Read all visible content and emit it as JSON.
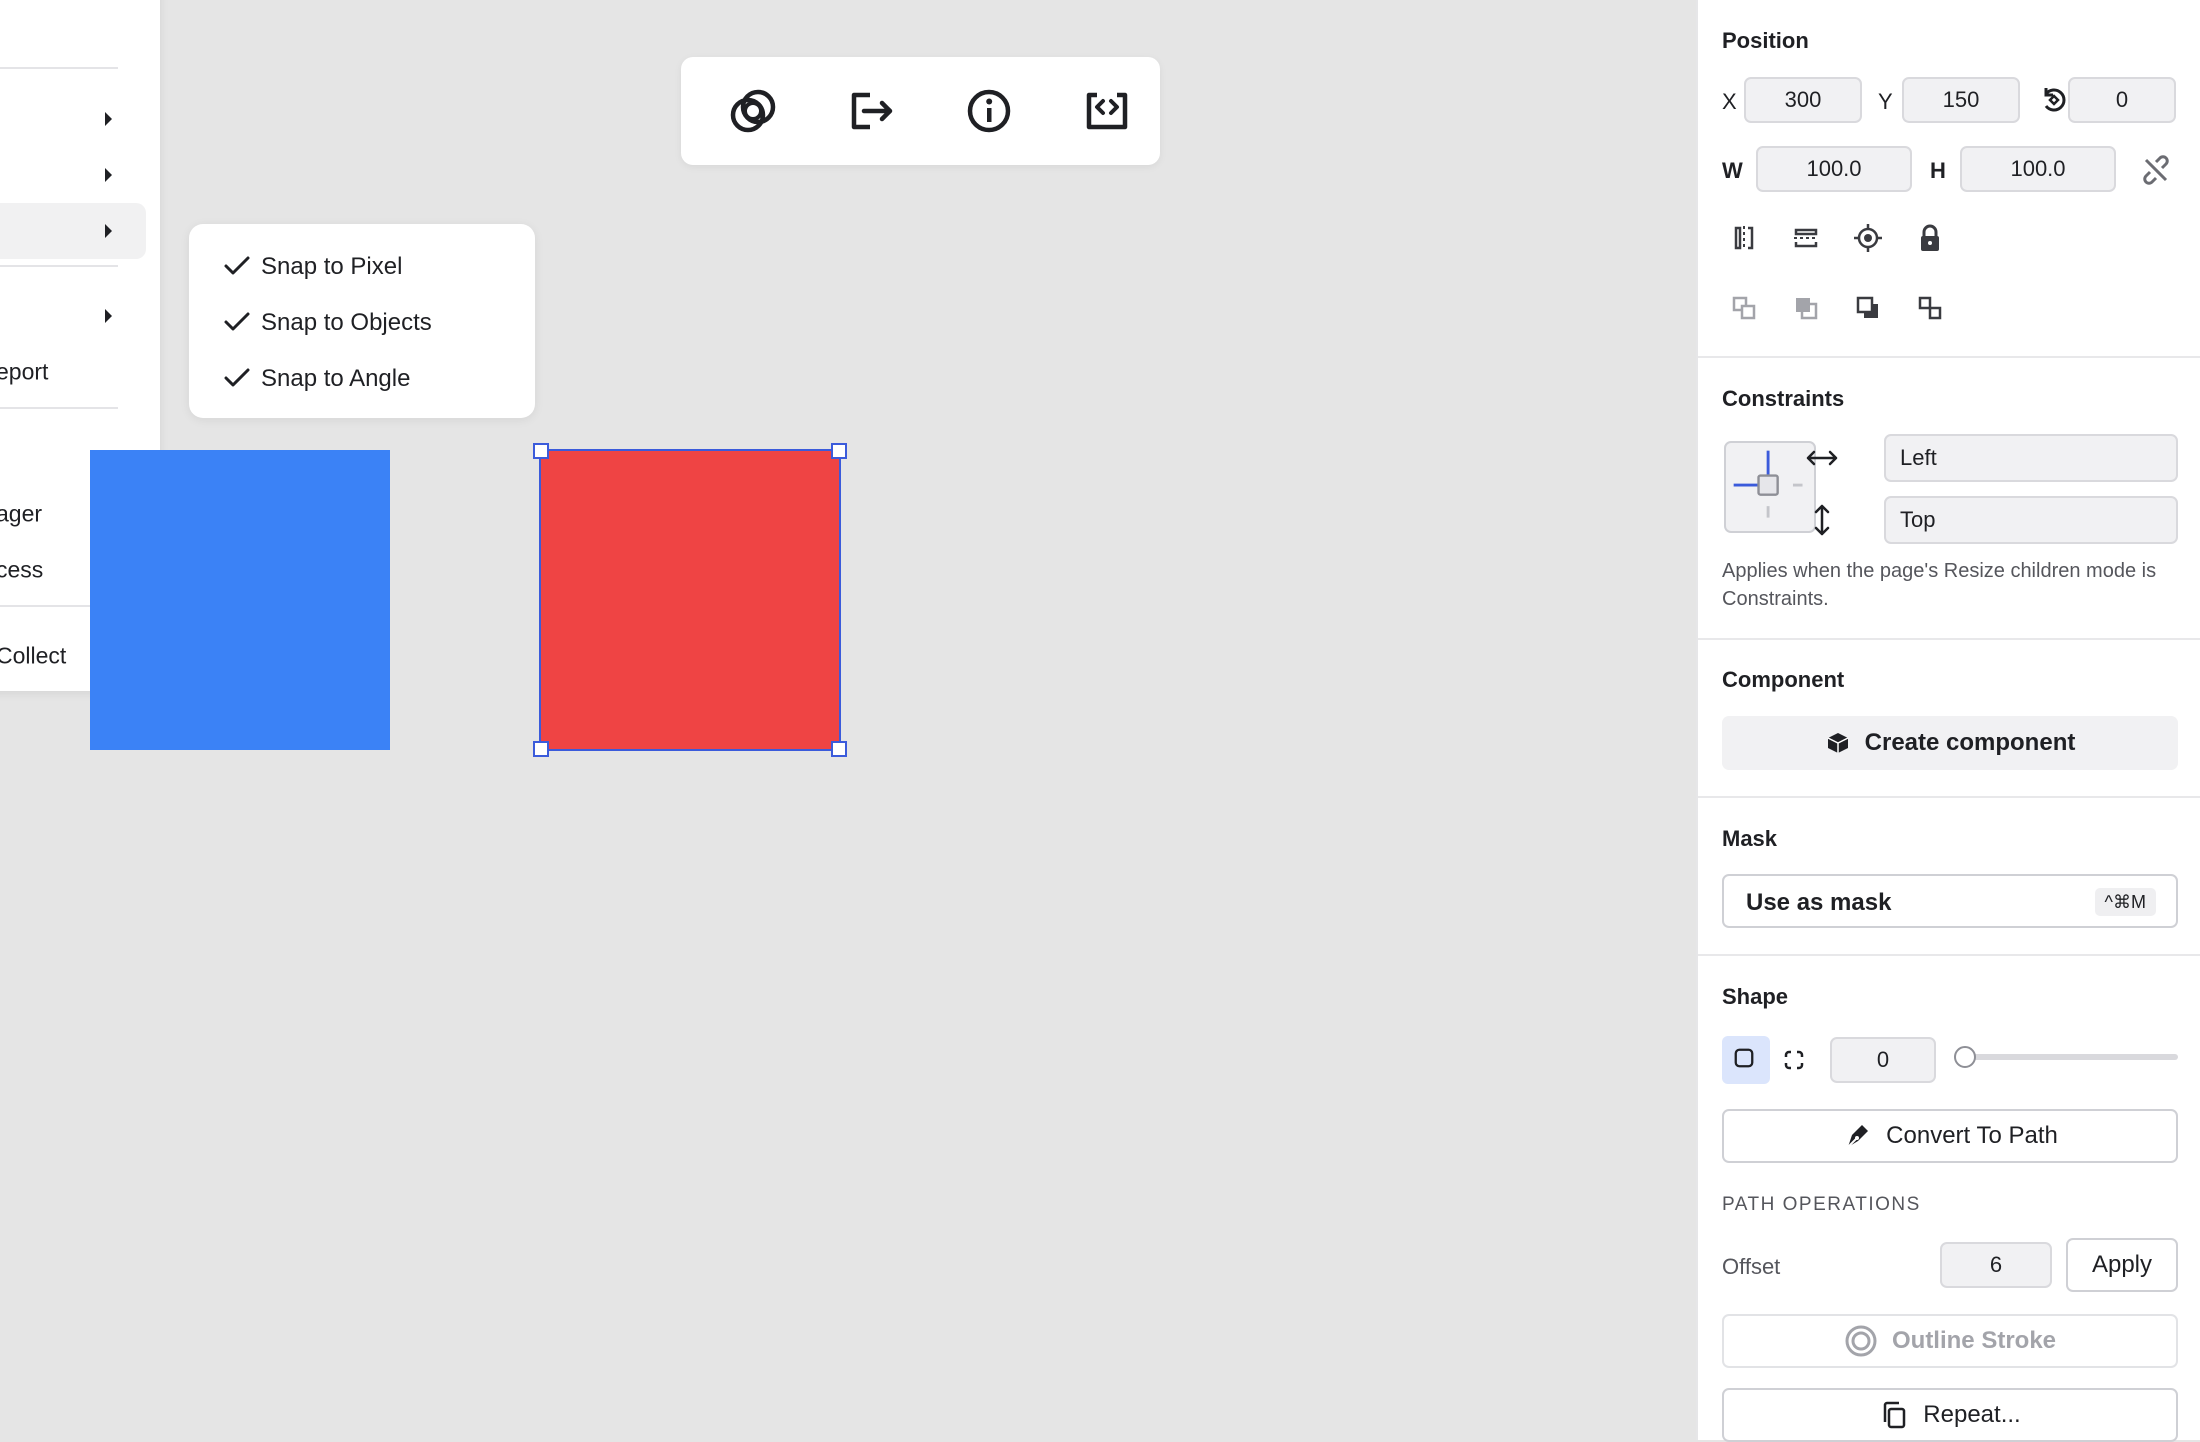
{
  "left_menu": {
    "items": [
      {
        "label": "",
        "has_submenu": true
      },
      {
        "label": "",
        "has_submenu": true
      },
      {
        "label": "",
        "has_submenu": true,
        "highlighted": true
      },
      {
        "label": "",
        "has_submenu": true
      },
      {
        "label": "eport",
        "has_submenu": false
      },
      {
        "label": "",
        "has_submenu": true
      },
      {
        "label": "ager",
        "has_submenu": false
      },
      {
        "label": "cess",
        "has_submenu": true
      },
      {
        "label": "Collect",
        "has_submenu": false
      }
    ]
  },
  "snap_menu": {
    "items": [
      {
        "label": "Snap to Pixel",
        "checked": true
      },
      {
        "label": "Snap to Objects",
        "checked": true
      },
      {
        "label": "Snap to Angle",
        "checked": true
      }
    ]
  },
  "toolbar": {
    "icons": [
      "boolean-union-icon",
      "export-icon",
      "info-icon",
      "embed-code-icon"
    ]
  },
  "canvas": {
    "shapes": [
      {
        "name": "blue-rectangle",
        "color": "#3b82f6"
      },
      {
        "name": "red-rectangle",
        "color": "#ef4444",
        "selected": true
      }
    ],
    "selection_color": "#3b5bdb"
  },
  "panel": {
    "position": {
      "title": "Position",
      "x_label": "X",
      "x_value": "300",
      "y_label": "Y",
      "y_value": "150",
      "rotation_value": "0",
      "w_label": "W",
      "w_value": "100.0",
      "h_label": "H",
      "h_value": "100.0"
    },
    "constraints": {
      "title": "Constraints",
      "horizontal": "Left",
      "vertical": "Top",
      "help": "Applies when the page's Resize children mode is Constraints."
    },
    "component": {
      "title": "Component",
      "button": "Create component"
    },
    "mask": {
      "title": "Mask",
      "button": "Use as mask",
      "shortcut": "^⌘M"
    },
    "shape": {
      "title": "Shape",
      "radius_value": "0",
      "radius_slider": 0,
      "convert_button": "Convert To Path",
      "path_ops_caption": "PATH OPERATIONS",
      "offset_label": "Offset",
      "offset_value": "6",
      "apply_button": "Apply",
      "outline_button": "Outline Stroke",
      "repeat_button": "Repeat..."
    }
  }
}
